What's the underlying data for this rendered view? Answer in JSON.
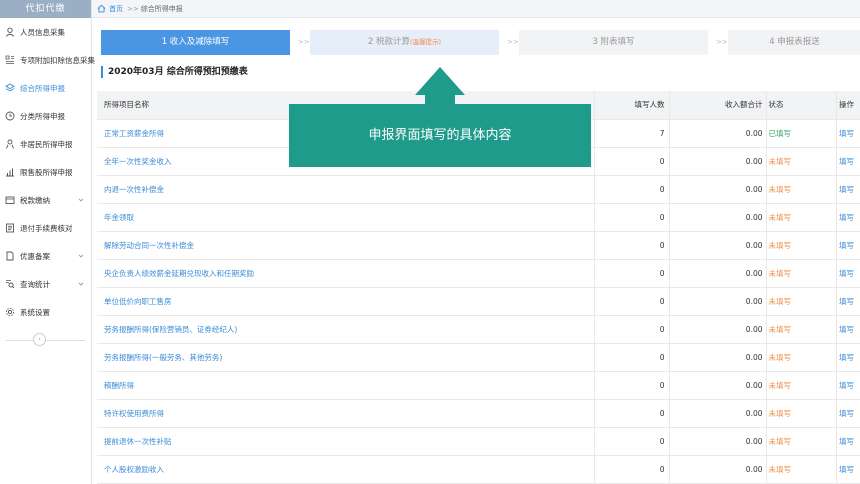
{
  "sidebar": {
    "brand": "代扣代缴",
    "items": [
      {
        "label": "人员信息采集",
        "icon": "person-icon",
        "active": false,
        "chevron": false
      },
      {
        "label": "专项附加扣除信息采集",
        "icon": "grid-icon",
        "active": false,
        "chevron": false
      },
      {
        "label": "综合所得申报",
        "icon": "layers-icon",
        "active": true,
        "chevron": false
      },
      {
        "label": "分类所得申报",
        "icon": "clock-icon",
        "active": false,
        "chevron": false
      },
      {
        "label": "非居民所得申报",
        "icon": "user-outline-icon",
        "active": false,
        "chevron": false
      },
      {
        "label": "限售股所得申报",
        "icon": "bar-chart-icon",
        "active": false,
        "chevron": false
      },
      {
        "label": "税款缴纳",
        "icon": "folder-icon",
        "active": false,
        "chevron": true
      },
      {
        "label": "退付手续费核对",
        "icon": "receipt-icon",
        "active": false,
        "chevron": false
      },
      {
        "label": "优惠备案",
        "icon": "document-icon",
        "active": false,
        "chevron": true
      },
      {
        "label": "查询统计",
        "icon": "query-icon",
        "active": false,
        "chevron": true
      },
      {
        "label": "系统设置",
        "icon": "gear-icon",
        "active": false,
        "chevron": false
      }
    ],
    "collapse_glyph": "‹"
  },
  "topbar": {
    "home": "首页",
    "sep": ">>",
    "current": "综合所得申报"
  },
  "steps": [
    {
      "label": "1 收入及减除填写",
      "sub": ""
    },
    {
      "label": "2 税款计算",
      "sub": "(温馨提示)"
    },
    {
      "label": "3 附表填写",
      "sub": ""
    },
    {
      "label": "4 申报表报送",
      "sub": ""
    }
  ],
  "step_sep": ">>",
  "section_title": "2020年03月  综合所得预扣预缴表",
  "table": {
    "headers": {
      "name": "所得项目名称",
      "count": "填写人数",
      "income": "收入额合计",
      "status": "状态",
      "op": "操作"
    },
    "rows": [
      {
        "name": "正常工资薪金所得",
        "count": "7",
        "income": "0.00",
        "status": "已填写",
        "done": true,
        "op": "填写"
      },
      {
        "name": "全年一次性奖金收入",
        "count": "0",
        "income": "0.00",
        "status": "未填写",
        "done": false,
        "op": "填写"
      },
      {
        "name": "内退一次性补偿金",
        "count": "0",
        "income": "0.00",
        "status": "未填写",
        "done": false,
        "op": "填写"
      },
      {
        "name": "年金领取",
        "count": "0",
        "income": "0.00",
        "status": "未填写",
        "done": false,
        "op": "填写"
      },
      {
        "name": "解除劳动合同一次性补偿金",
        "count": "0",
        "income": "0.00",
        "status": "未填写",
        "done": false,
        "op": "填写"
      },
      {
        "name": "央企负责人绩效薪金延期兑现收入和任期奖励",
        "count": "0",
        "income": "0.00",
        "status": "未填写",
        "done": false,
        "op": "填写"
      },
      {
        "name": "单位低价向职工售房",
        "count": "0",
        "income": "0.00",
        "status": "未填写",
        "done": false,
        "op": "填写"
      },
      {
        "name": "劳务报酬所得(保险营销员、证券经纪人)",
        "count": "0",
        "income": "0.00",
        "status": "未填写",
        "done": false,
        "op": "填写"
      },
      {
        "name": "劳务报酬所得(一般劳务、其他劳务)",
        "count": "0",
        "income": "0.00",
        "status": "未填写",
        "done": false,
        "op": "填写"
      },
      {
        "name": "稿酬所得",
        "count": "0",
        "income": "0.00",
        "status": "未填写",
        "done": false,
        "op": "填写"
      },
      {
        "name": "特许权使用费所得",
        "count": "0",
        "income": "0.00",
        "status": "未填写",
        "done": false,
        "op": "填写"
      },
      {
        "name": "提前退休一次性补贴",
        "count": "0",
        "income": "0.00",
        "status": "未填写",
        "done": false,
        "op": "填写"
      },
      {
        "name": "个人股权激励收入",
        "count": "0",
        "income": "0.00",
        "status": "未填写",
        "done": false,
        "op": "填写"
      }
    ]
  },
  "callout": {
    "text": "申报界面填写的具体内容",
    "color": "#1f9b8c"
  }
}
